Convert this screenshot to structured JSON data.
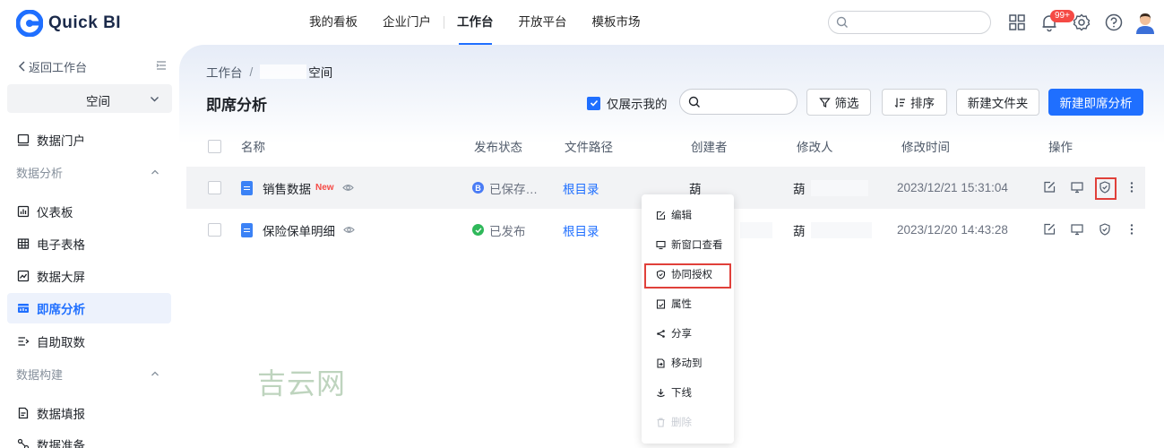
{
  "app": {
    "name": "Quick BI"
  },
  "topnav": [
    "我的看板",
    "企业门户",
    "工作台",
    "开放平台",
    "模板市场"
  ],
  "top_badge": "99+",
  "sidebar": {
    "back_label": "返回工作台",
    "space_name": "空间",
    "items": [
      {
        "label": "数据门户",
        "type": "item"
      },
      {
        "label": "数据分析",
        "type": "group"
      },
      {
        "label": "仪表板",
        "type": "item"
      },
      {
        "label": "电子表格",
        "type": "item"
      },
      {
        "label": "数据大屏",
        "type": "item"
      },
      {
        "label": "即席分析",
        "type": "item",
        "active": true
      },
      {
        "label": "自助取数",
        "type": "item"
      },
      {
        "label": "数据构建",
        "type": "group"
      },
      {
        "label": "数据填报",
        "type": "item"
      },
      {
        "label": "数据准备",
        "type": "item"
      }
    ]
  },
  "breadcrumb": {
    "root": "工作台",
    "separator": "/",
    "current": "空间"
  },
  "page_title": "即席分析",
  "toolbar": {
    "only_mine_label": "仅展示我的",
    "filter_label": "筛选",
    "sort_label": "排序",
    "new_folder_label": "新建文件夹",
    "new_analysis_label": "新建即席分析"
  },
  "table": {
    "headers": [
      "名称",
      "发布状态",
      "文件路径",
      "创建者",
      "修改人",
      "修改时间",
      "操作"
    ],
    "rows": [
      {
        "name": "销售数据",
        "tag": "New",
        "status": "已保存…",
        "status_kind": "saved",
        "path": "根目录",
        "creator": "葫",
        "modifier": "葫",
        "modified": "2023/12/21 15:31:04"
      },
      {
        "name": "保险保单明细",
        "tag": "",
        "status": "已发布",
        "status_kind": "published",
        "path": "根目录",
        "creator": "",
        "modifier": "葫",
        "modified": "2023/12/20 14:43:28"
      }
    ]
  },
  "context_menu": [
    {
      "label": "编辑",
      "icon": "edit-icon"
    },
    {
      "label": "新窗口查看",
      "icon": "monitor-icon"
    },
    {
      "label": "协同授权",
      "icon": "shield-icon",
      "highlighted": true
    },
    {
      "label": "属性",
      "icon": "property-icon"
    },
    {
      "label": "分享",
      "icon": "share-icon"
    },
    {
      "label": "移动到",
      "icon": "move-icon"
    },
    {
      "label": "下线",
      "icon": "offline-icon"
    },
    {
      "label": "删除",
      "icon": "delete-icon",
      "disabled": true
    }
  ],
  "watermark": "吉云网",
  "colors": {
    "accent": "#1f6fff",
    "highlight": "#e0403a",
    "new_tag": "#f54a45"
  }
}
